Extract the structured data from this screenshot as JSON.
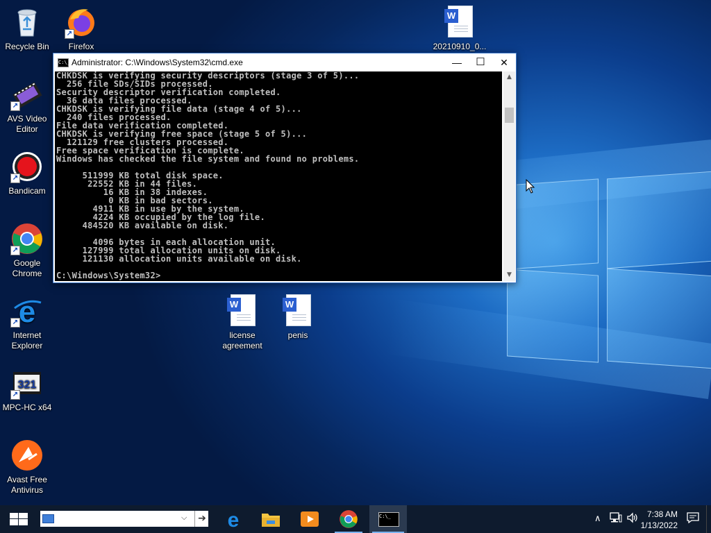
{
  "desktop_icons": {
    "recycle_bin": "Recycle Bin",
    "firefox": "Firefox",
    "document_top": "20210910_0...",
    "avs": "AVS Video Editor",
    "bandicam": "Bandicam",
    "chrome": "Google Chrome",
    "ie": "Internet Explorer",
    "mpc": "MPC-HC x64",
    "avast": "Avast Free Antivirus",
    "license": "license agreement",
    "penis": "penis"
  },
  "cmd_window": {
    "title": "Administrator: C:\\Windows\\System32\\cmd.exe",
    "minimize": "—",
    "maximize": "☐",
    "close": "✕",
    "output": "CHKDSK is verifying security descriptors (stage 3 of 5)...\n  256 file SDs/SIDs processed.\nSecurity descriptor verification completed.\n  36 data files processed.\nCHKDSK is verifying file data (stage 4 of 5)...\n  240 files processed.\nFile data verification completed.\nCHKDSK is verifying free space (stage 5 of 5)...\n  121129 free clusters processed.\nFree space verification is complete.\nWindows has checked the file system and found no problems.\n\n     511999 KB total disk space.\n      22552 KB in 44 files.\n         16 KB in 38 indexes.\n          0 KB in bad sectors.\n       4911 KB in use by the system.\n       4224 KB occupied by the log file.\n     484520 KB available on disk.\n\n       4096 bytes in each allocation unit.\n     127999 total allocation units on disk.\n     121130 allocation units available on disk.\n\nC:\\Windows\\System32>"
  },
  "taskbar": {
    "search_value": "",
    "clock_time": "7:38 AM",
    "clock_date": "1/13/2022"
  },
  "colors": {
    "taskbar": "#0e1b2e",
    "console_bg": "#000000",
    "console_text": "#c0c0c0",
    "window_border": "#3b77c9"
  }
}
